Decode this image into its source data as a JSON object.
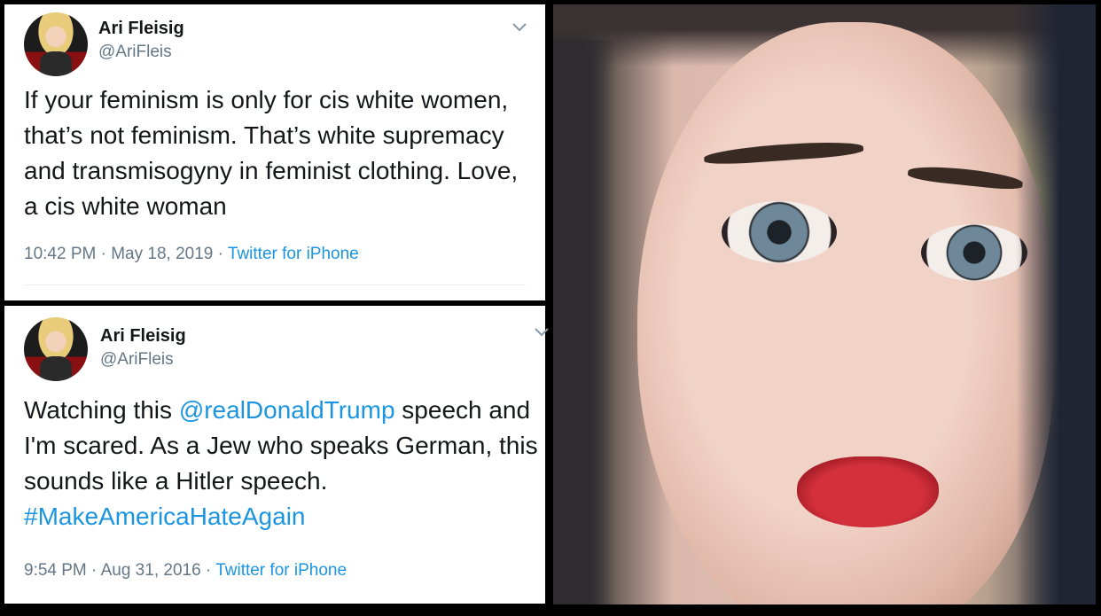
{
  "tweets": [
    {
      "name": "Ari Fleisig",
      "handle": "@AriFleis",
      "text": "If your feminism is only for cis white women, that’s not feminism. That’s white supremacy and transmisogyny in feminist clothing. Love, a cis white woman",
      "time": "10:42 PM · May 18, 2019 · ",
      "source": "Twitter for iPhone"
    },
    {
      "name": "Ari Fleisig",
      "handle": "@AriFleis",
      "text_before": "Watching this ",
      "mention": "@realDonaldTrump",
      "text_after": " speech and I'm scared. As a Jew who speaks German, this sounds like a Hitler speech. ",
      "hashtag": "#MakeAmericaHateAgain",
      "time": "9:54 PM · Aug 31, 2016 · ",
      "source": "Twitter for iPhone"
    }
  ],
  "colors": {
    "link": "#1b95e0",
    "secondary_text": "#657786",
    "primary_text": "#14171a",
    "background": "#000000"
  },
  "icons": {
    "menu": "chevron-down-icon"
  }
}
